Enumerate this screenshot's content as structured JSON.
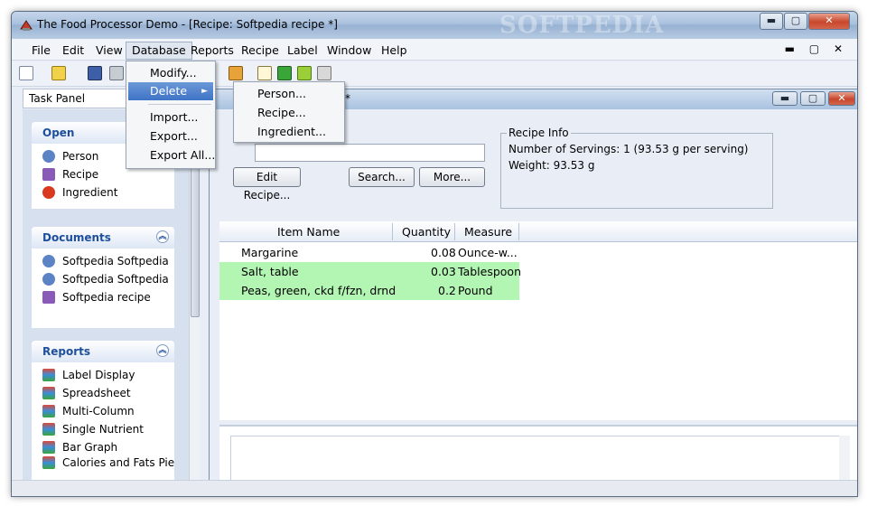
{
  "window": {
    "title": "The Food Processor Demo - [Recipe: Softpedia recipe *]",
    "watermark": "SOFTPEDIA",
    "controls": {
      "minimize": "▬",
      "maximize": "▢",
      "close": "✕"
    }
  },
  "menubar": {
    "items": [
      "File",
      "Edit",
      "View",
      "Database",
      "Reports",
      "Recipe",
      "Label",
      "Window",
      "Help"
    ],
    "active": "Database",
    "mdi_controls": "▬ ▢ ✕"
  },
  "database_menu": {
    "items": [
      "Modify...",
      "Delete",
      "Import...",
      "Export...",
      "Export All..."
    ],
    "highlighted": "Delete",
    "submenu_arrow": "►"
  },
  "delete_submenu": {
    "items": [
      "Person...",
      "Recipe...",
      "Ingredient..."
    ]
  },
  "task_panel": {
    "title": "Task Panel",
    "sections": [
      {
        "title": "Open",
        "items": [
          "Person",
          "Recipe",
          "Ingredient"
        ]
      },
      {
        "title": "Documents",
        "items": [
          "Softpedia Softpedia",
          "Softpedia Softpedia",
          "Softpedia recipe"
        ]
      },
      {
        "title": "Reports",
        "items": [
          "Label Display",
          "Spreadsheet",
          "Multi-Column",
          "Single Nutrient",
          "Bar Graph",
          "Calories and Fats Pie Chart"
        ]
      }
    ],
    "chevron": "︽"
  },
  "recipe_window": {
    "title_suffix": "*",
    "buttons": {
      "edit_recipe": "Edit Recipe...",
      "search": "Search...",
      "more": "More..."
    },
    "recipe_info": {
      "legend": "Recipe Info",
      "servings": "Number of Servings: 1  (93.53 g per serving)",
      "weight": "Weight: 93.53 g"
    }
  },
  "ingredients_table": {
    "columns": [
      "Item Name",
      "Quantity",
      "Measure"
    ],
    "rows": [
      {
        "name": "Margarine",
        "quantity": "0.08",
        "measure": "Ounce-w...",
        "highlight": false
      },
      {
        "name": "Salt, table",
        "quantity": "0.03",
        "measure": "Tablespoon",
        "highlight": true
      },
      {
        "name": "Peas, green, ckd f/fzn, drnd",
        "quantity": "0.2",
        "measure": "Pound",
        "highlight": true
      }
    ]
  },
  "colors": {
    "row_highlight": "#b3f5b3",
    "menu_highlight": "#3f73c6",
    "section_title": "#1d4f9c"
  }
}
